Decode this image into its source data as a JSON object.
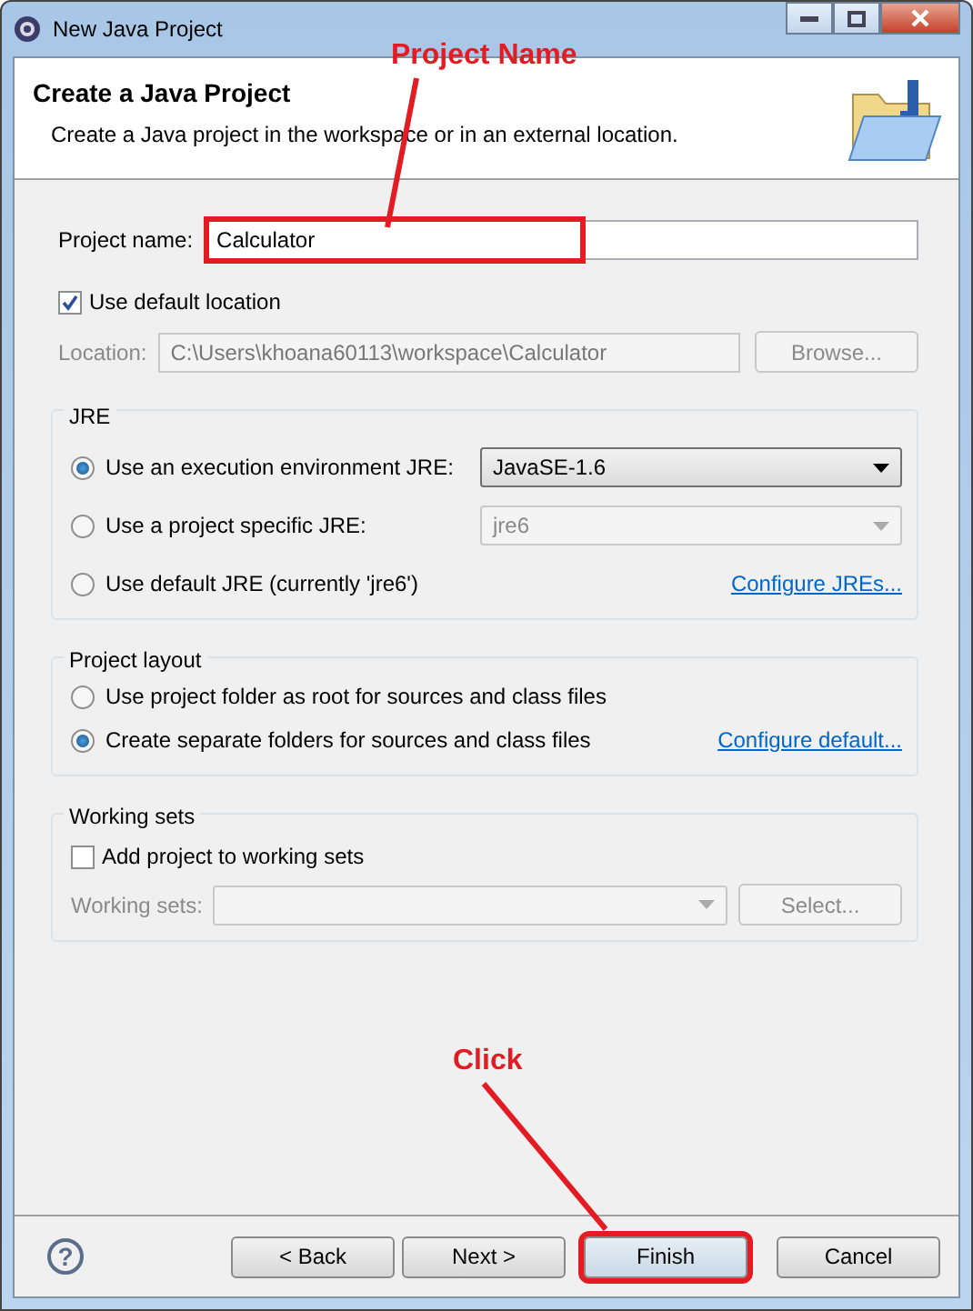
{
  "window": {
    "title": "New Java Project"
  },
  "header": {
    "title": "Create a Java Project",
    "description": "Create a Java project in the workspace or in an external location."
  },
  "project_name": {
    "label": "Project name:",
    "value": "Calculator",
    "highlighted": true
  },
  "use_default_location": {
    "label": "Use default location",
    "checked": true
  },
  "location": {
    "label": "Location:",
    "value": "C:\\Users\\khoana60113\\workspace\\Calculator",
    "button": "Browse..."
  },
  "jre": {
    "title": "JRE",
    "options": [
      {
        "label": "Use an execution environment JRE:",
        "selected": true,
        "dropdown": "JavaSE-1.6"
      },
      {
        "label": "Use a project specific JRE:",
        "selected": false,
        "dropdown": "jre6"
      },
      {
        "label": "Use default JRE (currently 'jre6')",
        "selected": false,
        "link": "Configure JREs..."
      }
    ]
  },
  "project_layout": {
    "title": "Project layout",
    "options": [
      {
        "label": "Use project folder as root for sources and class files",
        "selected": false
      },
      {
        "label": "Create separate folders for sources and class files",
        "selected": true,
        "link": "Configure default..."
      }
    ]
  },
  "working_sets": {
    "title": "Working sets",
    "checkbox": {
      "label": "Add project to working sets",
      "checked": false
    },
    "field_label": "Working sets:",
    "button": "Select..."
  },
  "help": "?",
  "buttons": [
    {
      "label": "< Back",
      "highlighted": false
    },
    {
      "label": "Next >",
      "highlighted": false
    },
    {
      "label": "Finish",
      "highlighted": true
    },
    {
      "label": "Cancel",
      "highlighted": false
    }
  ],
  "annotations": [
    {
      "text": "Project Name"
    },
    {
      "text": "Click"
    }
  ]
}
